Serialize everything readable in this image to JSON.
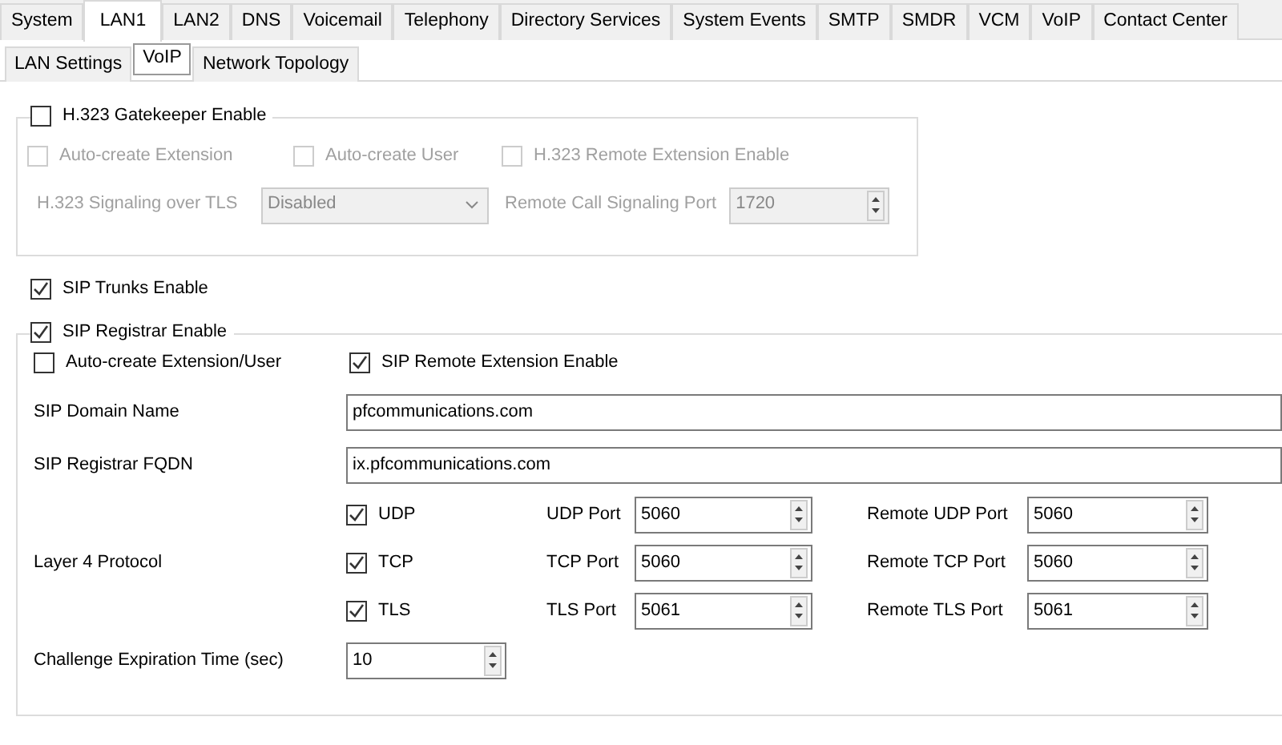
{
  "tabs": [
    {
      "label": "System",
      "selected": false
    },
    {
      "label": "LAN1",
      "selected": true
    },
    {
      "label": "LAN2",
      "selected": false
    },
    {
      "label": "DNS",
      "selected": false
    },
    {
      "label": "Voicemail",
      "selected": false
    },
    {
      "label": "Telephony",
      "selected": false
    },
    {
      "label": "Directory Services",
      "selected": false
    },
    {
      "label": "System Events",
      "selected": false
    },
    {
      "label": "SMTP",
      "selected": false
    },
    {
      "label": "SMDR",
      "selected": false
    },
    {
      "label": "VCM",
      "selected": false
    },
    {
      "label": "VoIP",
      "selected": false
    },
    {
      "label": "Contact Center",
      "selected": false
    }
  ],
  "subtabs": [
    {
      "label": "LAN Settings",
      "selected": false
    },
    {
      "label": "VoIP",
      "selected": true
    },
    {
      "label": "Network Topology",
      "selected": false
    }
  ],
  "h323": {
    "enable": {
      "label": "H.323 Gatekeeper Enable",
      "checked": false
    },
    "disabled": true,
    "options": [
      {
        "label": "Auto-create Extension",
        "checked": false
      },
      {
        "label": "Auto-create User",
        "checked": false
      },
      {
        "label": "H.323 Remote Extension Enable",
        "checked": false
      }
    ],
    "signaling_label": "H.323 Signaling over TLS",
    "signaling_value": "Disabled",
    "port_label": "Remote Call Signaling Port",
    "port_value": "1720"
  },
  "sip_trunks": {
    "label": "SIP Trunks Enable",
    "checked": true
  },
  "sip_registrar": {
    "enable": {
      "label": "SIP Registrar Enable",
      "checked": true
    },
    "auto_create": {
      "label": "Auto-create Extension/User",
      "checked": false
    },
    "remote_extension": {
      "label": "SIP Remote Extension Enable",
      "checked": true
    },
    "domain_label": "SIP Domain Name",
    "domain_value": "pfcommunications.com",
    "fqdn_label": "SIP Registrar FQDN",
    "fqdn_value": "ix.pfcommunications.com",
    "layer4_label": "Layer 4 Protocol",
    "protocols": [
      {
        "label": "UDP",
        "checked": true,
        "port_label": "UDP Port",
        "port_value": "5060",
        "remote_label": "Remote UDP Port",
        "remote_value": "5060"
      },
      {
        "label": "TCP",
        "checked": true,
        "port_label": "TCP Port",
        "port_value": "5060",
        "remote_label": "Remote TCP Port",
        "remote_value": "5060"
      },
      {
        "label": "TLS",
        "checked": true,
        "port_label": "TLS Port",
        "port_value": "5061",
        "remote_label": "Remote TLS Port",
        "remote_value": "5061"
      }
    ],
    "challenge_label": "Challenge Expiration Time (sec)",
    "challenge_value": "10"
  }
}
